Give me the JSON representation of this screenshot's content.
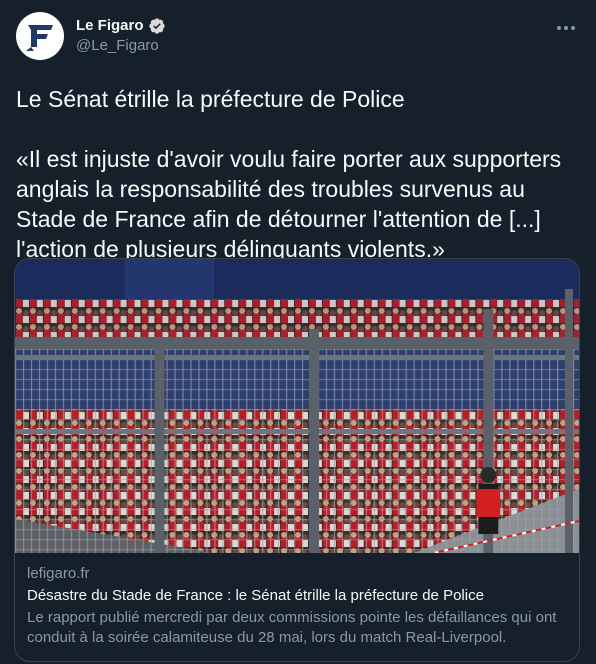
{
  "author": {
    "display_name": "Le Figaro",
    "handle": "@Le_Figaro",
    "avatar_icon": "le-figaro-logo",
    "verified_icon": "verified-badge-icon"
  },
  "menu_icon": "more-horizontal-icon",
  "tweet": {
    "text": "Le Sénat étrille la préfecture de Police\n\n«Il est injuste d'avoir voulu faire porter aux supporters anglais la responsabilité des troubles survenus au Stade de France afin de détourner l'attention de [...] l'action de plusieurs délinquants violents.»"
  },
  "link_card": {
    "image_description": "crowd-behind-fences-photo",
    "domain": "lefigaro.fr",
    "title": "Désastre du Stade de France : le Sénat étrille la préfecture de Police",
    "description": "Le rapport publié mercredi par deux commissions pointe les défaillances qui ont conduit à la soirée calamiteuse du 28 mai, lors du match Real-Liverpool."
  },
  "colors": {
    "background": "#15202b",
    "text": "#f7f9f9",
    "secondary_text": "#8b98a5",
    "border": "#38444d",
    "verified": "#1d9bf0"
  }
}
